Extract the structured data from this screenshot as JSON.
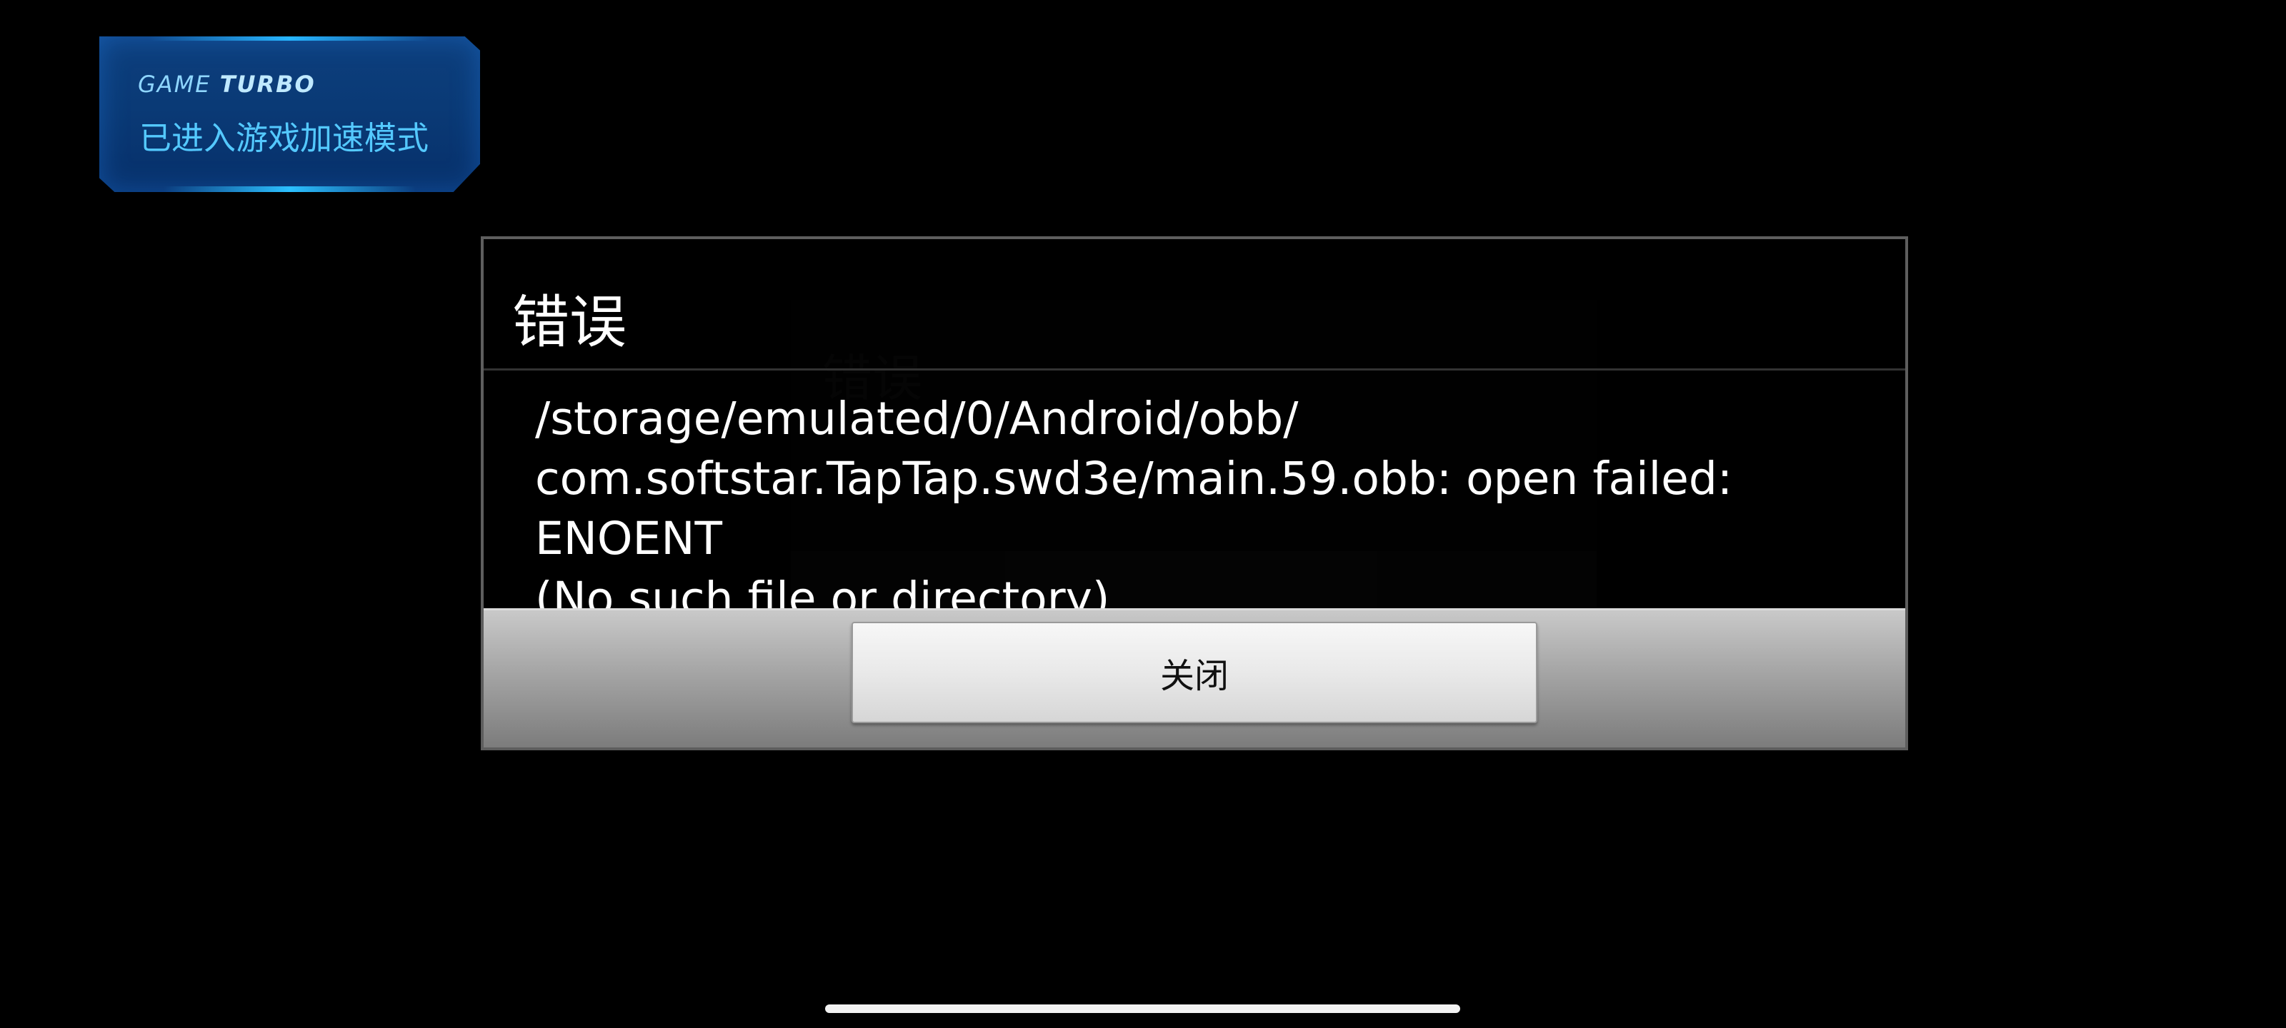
{
  "game_turbo": {
    "title_prefix": "GAME ",
    "title_bold": "TURBO",
    "message": "已进入游戏加速模式"
  },
  "background_dialog": {
    "title": "错误"
  },
  "error_dialog": {
    "title": "错误",
    "message": "/storage/emulated/0/Android/obb/\ncom.softstar.TapTap.swd3e/main.59.obb: open failed: ENOENT\n(No such file or directory)",
    "close_button_label": "关闭"
  },
  "colors": {
    "background": "#000000",
    "turbo_accent": "#54c9ff",
    "dialog_border": "#5e5e5e",
    "button_bg": "#e9e9e9"
  }
}
